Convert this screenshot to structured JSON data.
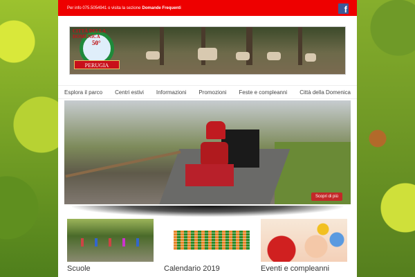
{
  "topbar": {
    "info": "Per info 075.5054941 o visita la sezione",
    "link": "Domande Frequenti",
    "facebook_icon": "facebook-icon"
  },
  "logo": {
    "arc": "CITTÀ DELLA DOMENICA",
    "badge": "50°",
    "ribbon": "PERUGIA"
  },
  "nav": [
    "Esplora il parco",
    "Centri estivi",
    "Informazioni",
    "Promozioni",
    "Feste e compleanni",
    "Città della Domenica"
  ],
  "slider": {
    "button": "Scopri di più"
  },
  "cards": [
    {
      "title": "Scuole"
    },
    {
      "title": "Calendario 2019"
    },
    {
      "title": "Eventi e compleanni"
    }
  ],
  "colors": {
    "topbar": "#e00000",
    "accent": "#c32828"
  }
}
